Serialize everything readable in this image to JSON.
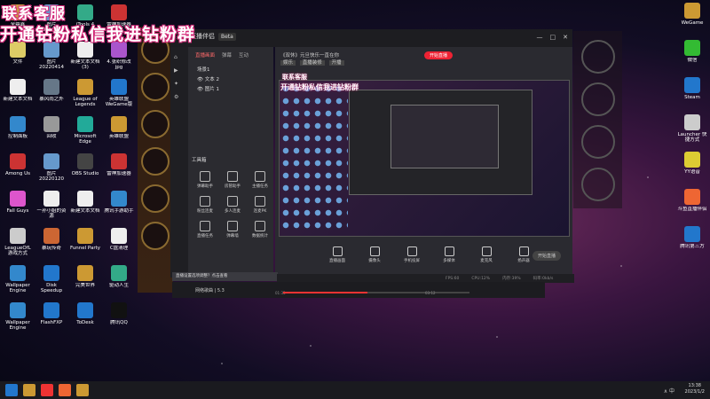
{
  "overlay": {
    "line1": "联系客服",
    "line2": "开通钻粉私信我进钻粉群",
    "small1": "联系客服",
    "small2": "开通钻粉私信我进钻粉群"
  },
  "desktop_icons": [
    {
      "label": "全鼎鑫",
      "color": "#c94"
    },
    {
      "label": "图片 20220120",
      "color": "#69c"
    },
    {
      "label": "iTools 4",
      "color": "#3a8"
    },
    {
      "label": "雷神加速器",
      "color": "#c33"
    },
    {
      "label": "文件",
      "color": "#dc6"
    },
    {
      "label": "图片 20220414",
      "color": "#69c"
    },
    {
      "label": "新建文本文档 (3)",
      "color": "#eee"
    },
    {
      "label": "4.张织修改 jpg",
      "color": "#a5c"
    },
    {
      "label": "新建文本文档",
      "color": "#eee"
    },
    {
      "label": "暴风雨之外",
      "color": "#678"
    },
    {
      "label": "League of Legends",
      "color": "#c93"
    },
    {
      "label": "英雄联盟 WeGame版",
      "color": "#27c"
    },
    {
      "label": "控制面板",
      "color": "#38c"
    },
    {
      "label": "回收",
      "color": "#999"
    },
    {
      "label": "Microsoft Edge",
      "color": "#2a9"
    },
    {
      "label": "英雄联盟",
      "color": "#c93"
    },
    {
      "label": "Among Us",
      "color": "#c33"
    },
    {
      "label": "图片 20220120",
      "color": "#69c"
    },
    {
      "label": "OBS Studio",
      "color": "#444"
    },
    {
      "label": "雷神加速器",
      "color": "#c33"
    },
    {
      "label": "Fall Guys",
      "color": "#d5c"
    },
    {
      "label": "一孙小姐的资源",
      "color": "#eee"
    },
    {
      "label": "新建文本文档",
      "color": "#eee"
    },
    {
      "label": "腾讯手游助手",
      "color": "#38c"
    },
    {
      "label": "LeagueOfL 游戏方式",
      "color": "#ccc"
    },
    {
      "label": "暴玩传奇",
      "color": "#c63"
    },
    {
      "label": "Funnel Party",
      "color": "#c93"
    },
    {
      "label": "C盘清理",
      "color": "#eee"
    },
    {
      "label": "Wallpaper Engine",
      "color": "#38c"
    },
    {
      "label": "Disk Speedup",
      "color": "#27c"
    },
    {
      "label": "完美世界",
      "color": "#c93"
    },
    {
      "label": "驱动人生",
      "color": "#3a8"
    },
    {
      "label": "Wallpaper Engine",
      "color": "#38c"
    },
    {
      "label": "FlashFXP",
      "color": "#27c"
    },
    {
      "label": "ToDesk",
      "color": "#27c"
    },
    {
      "label": "腾讯QQ",
      "color": "#111"
    }
  ],
  "right_icons": [
    {
      "label": "WeGame",
      "color": "#c93"
    },
    {
      "label": "微信",
      "color": "#3b3"
    },
    {
      "label": "Steam",
      "color": "#27c"
    },
    {
      "label": "Launcher 快捷方式",
      "color": "#ccc"
    },
    {
      "label": "YY语音",
      "color": "#dc3"
    },
    {
      "label": "斗鱼直播伴侣",
      "color": "#e63"
    },
    {
      "label": "腾讯第三方",
      "color": "#27c"
    }
  ],
  "app": {
    "logo": "斗鱼直播伴侣",
    "version_badge": "Beta",
    "window_controls": [
      "—",
      "□",
      "✕"
    ],
    "tabs": [
      "直播画面",
      "弹幕",
      "互动"
    ],
    "scenes": [
      "场景1",
      "文本 2",
      "图片 1"
    ],
    "tools_title": "工具箱",
    "tools": [
      "弹幕助手",
      "房管助手",
      "主播任务",
      "粉丝连麦",
      "多人连麦",
      "连麦PK",
      "直播任务",
      "弹幕墙",
      "数据统计"
    ],
    "room_title": "《双休》元旦快乐一直在你",
    "room_tags": [
      "娱乐",
      "直播装修",
      "开播"
    ],
    "live_button": "开始直播",
    "controls": [
      "直播画面",
      "摄像头",
      "手机投屏",
      "多媒体",
      "麦克风",
      "扬声器"
    ],
    "go_live": "开始直播",
    "notice": "直播设置选项调整？点击查看",
    "status": [
      "FPS:60",
      "CPU:12%",
      "内存:39%",
      "码率:0kb/s"
    ],
    "music_title": "网络歌曲 | 5.3",
    "time_start": "01:33",
    "time_end": "03:12",
    "progress": 0.45
  },
  "taskbar": {
    "time": "13:38",
    "date": "2023/1/2",
    "tray": "∧ 中"
  }
}
